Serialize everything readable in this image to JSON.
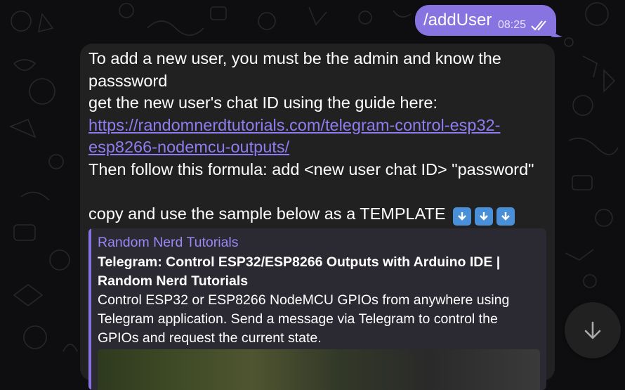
{
  "outgoing": {
    "text": "/addUser",
    "time": "08:25",
    "status_icon": "double-check-icon",
    "color": "#8774e1"
  },
  "incoming": {
    "line1": "To add a new user, you must be the admin and know the",
    "line2": "passsword",
    "line3": "get the new user's chat ID using the guide here:",
    "link_line1": "https://randomnerdtutorials.com/telegram-control-esp32-",
    "link_line2": "esp8266-nodemcu-outputs/",
    "line4": "Then follow this formula: add <new user chat ID> \"password\"",
    "line5": "copy and use the sample below as a TEMPLATE",
    "emoji_icons": [
      "down-arrow-emoji-icon",
      "down-arrow-emoji-icon",
      "down-arrow-emoji-icon"
    ],
    "link_color": "#8e7cf0"
  },
  "preview": {
    "site_name": "Random Nerd Tutorials",
    "title_line1": "Telegram: Control ESP32/ESP8266 Outputs with Arduino IDE |",
    "title_line2": "Random Nerd Tutorials",
    "desc_line1": "Control ESP32 or ESP8266 NodeMCU GPIOs from anywhere using",
    "desc_line2": "Telegram application. Send a message via Telegram to control the",
    "desc_line3": "GPIOs and request the current state.",
    "accent": "#8774e1"
  },
  "scroll_button": {
    "icon": "arrow-down-icon"
  }
}
